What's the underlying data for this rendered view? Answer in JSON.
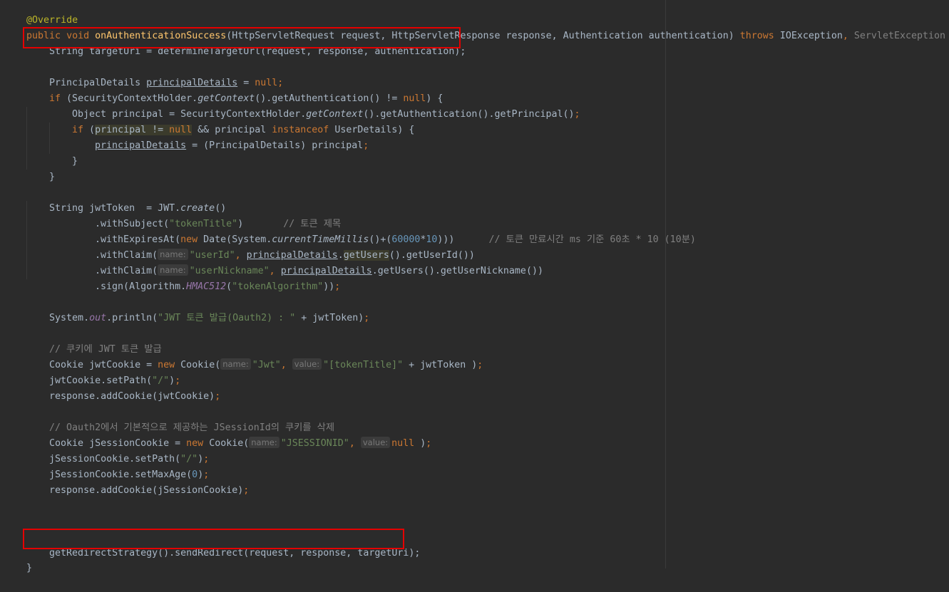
{
  "editor": {
    "annotation": "@Override",
    "signature": {
      "kw_public": "public",
      "kw_void": "void",
      "method_name": "onAuthenticationSuccess",
      "params": "(HttpServletRequest request, HttpServletResponse response, Authentication authentication) ",
      "kw_throws": "throws",
      "exc1": " IOException",
      "comma": ",",
      "exc2": " ServletException",
      "brace": " {"
    },
    "line_target_uri": "String targetUri = determineTargetUrl(request, response, authentication);",
    "line_principal_decl": {
      "type": "PrincipalDetails ",
      "var": "principalDetails",
      "eq": " = ",
      "kw_null": "null",
      "semi": ";"
    },
    "line_if1": {
      "kw_if": "if",
      "a": " (SecurityContextHolder.",
      "getContext": "getContext",
      "b": "().getAuthentication() != ",
      "kw_null": "null",
      "c": ") {"
    },
    "line_object": {
      "a": "Object principal = SecurityContextHolder.",
      "getContext": "getContext",
      "b": "().getAuthentication().getPrincipal()",
      "semi": ";"
    },
    "line_if2": {
      "kw_if": "if",
      "paren": " (",
      "hl_text": "principal != ",
      "kw_null": "null",
      "a": " && principal ",
      "kw_instanceof": "instanceof",
      "b": " UserDetails) {"
    },
    "line_assign": {
      "var": "principalDetails",
      "a": " = (PrincipalDetails) principal",
      "semi": ";"
    },
    "close_brace": "}",
    "line_jwt_decl": {
      "a": "String jwtToken  = JWT.",
      "create": "create",
      "b": "()"
    },
    "line_with_subject": {
      "a": ".withSubject(",
      "str": "\"tokenTitle\"",
      "b": ")       ",
      "comment": "// 토큰 제목"
    },
    "line_with_expires": {
      "a": ".withExpiresAt(",
      "kw_new": "new",
      "b": " Date(System.",
      "ctm": "currentTimeMillis",
      "c": "()+(",
      "n1": "60000",
      "d": "*",
      "n2": "10",
      "e": ")))      ",
      "comment": "// 토큰 만료시간 ms 기준 60초 * 10 (10분)"
    },
    "line_with_claim1": {
      "a": ".withClaim(",
      "hint": "name:",
      "str": "\"userId\"",
      "comma": ",",
      "sp": " ",
      "var": "principalDetails",
      "dot": ".",
      "get_users": "getUsers",
      "b": "().getUserId())"
    },
    "line_with_claim2": {
      "a": ".withClaim(",
      "hint": "name:",
      "str": "\"userNickname\"",
      "comma": ",",
      "sp": " ",
      "var": "principalDetails",
      "b": ".getUsers().getUserNickname())"
    },
    "line_sign": {
      "a": ".sign(Algorithm.",
      "hmac": "HMAC512",
      "b": "(",
      "str": "\"tokenAlgorithm\"",
      "c": "))",
      "semi": ";"
    },
    "line_println": {
      "a": "System.",
      "out": "out",
      "b": ".println(",
      "str": "\"JWT 토큰 발급(Oauth2) : \"",
      "c": " + jwtToken)",
      "semi": ";"
    },
    "comment_cookie": "// 쿠키에 JWT 토큰 발급",
    "line_cookie_decl": {
      "a": "Cookie jwtCookie = ",
      "kw_new": "new",
      "b": " Cookie(",
      "hint_name": "name:",
      "str1": "\"Jwt\"",
      "comma": ",",
      "hint_value": "value:",
      "str2": "\"[tokenTitle]\"",
      "c": " + jwtToken )",
      "semi": ";"
    },
    "line_set_path": {
      "a": "jwtCookie.setPath(",
      "str": "\"/\"",
      "b": ")",
      "semi": ";"
    },
    "line_add_cookie": {
      "a": "response.addCookie(jwtCookie)",
      "semi": ";"
    },
    "comment_jsession": "// Oauth2에서 기본적으로 제공하는 JSessionId의 쿠키를 삭제",
    "line_jsession_decl": {
      "a": "Cookie jSessionCookie = ",
      "kw_new": "new",
      "b": " Cookie(",
      "hint_name": "name:",
      "str1": "\"JSESSIONID\"",
      "comma": ",",
      "hint_value": "value:",
      "kw_null": "null",
      "c": " )",
      "semi": ";"
    },
    "line_jsession_path": {
      "a": "jSessionCookie.setPath(",
      "str": "\"/\"",
      "b": ")",
      "semi": ";"
    },
    "line_jsession_maxage": {
      "a": "jSessionCookie.setMaxAge(",
      "num": "0",
      "b": ")",
      "semi": ";"
    },
    "line_jsession_add": {
      "a": "response.addCookie(jSessionCookie)",
      "semi": ";"
    },
    "line_redirect": "getRedirectStrategy().sendRedirect(request, response, targetUri);",
    "final_brace": "}"
  }
}
